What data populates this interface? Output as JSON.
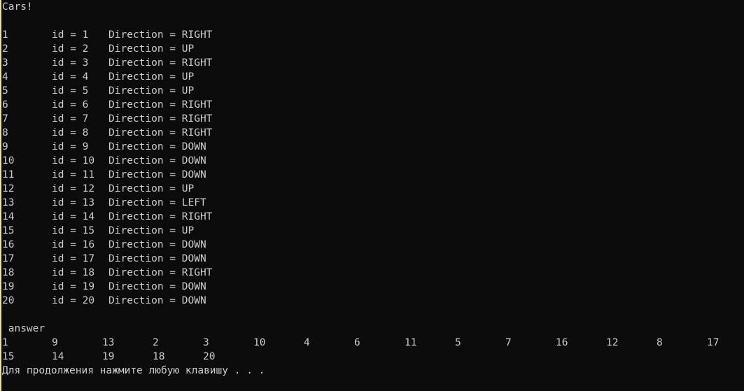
{
  "title": "Cars!",
  "cars": [
    {
      "n": "1",
      "id": "id = 1",
      "dir": "Direction = RIGHT"
    },
    {
      "n": "2",
      "id": "id = 2",
      "dir": "Direction = UP"
    },
    {
      "n": "3",
      "id": "id = 3",
      "dir": "Direction = RIGHT"
    },
    {
      "n": "4",
      "id": "id = 4",
      "dir": "Direction = UP"
    },
    {
      "n": "5",
      "id": "id = 5",
      "dir": "Direction = UP"
    },
    {
      "n": "6",
      "id": "id = 6",
      "dir": "Direction = RIGHT"
    },
    {
      "n": "7",
      "id": "id = 7",
      "dir": "Direction = RIGHT"
    },
    {
      "n": "8",
      "id": "id = 8",
      "dir": "Direction = RIGHT"
    },
    {
      "n": "9",
      "id": "id = 9",
      "dir": "Direction = DOWN"
    },
    {
      "n": "10",
      "id": "id = 10",
      "dir": "Direction = DOWN"
    },
    {
      "n": "11",
      "id": "id = 11",
      "dir": "Direction = DOWN"
    },
    {
      "n": "12",
      "id": "id = 12",
      "dir": "Direction = UP"
    },
    {
      "n": "13",
      "id": "id = 13",
      "dir": "Direction = LEFT"
    },
    {
      "n": "14",
      "id": "id = 14",
      "dir": "Direction = RIGHT"
    },
    {
      "n": "15",
      "id": "id = 15",
      "dir": "Direction = UP"
    },
    {
      "n": "16",
      "id": "id = 16",
      "dir": "Direction = DOWN"
    },
    {
      "n": "17",
      "id": "id = 17",
      "dir": "Direction = DOWN"
    },
    {
      "n": "18",
      "id": "id = 18",
      "dir": "Direction = RIGHT"
    },
    {
      "n": "19",
      "id": "id = 19",
      "dir": "Direction = DOWN"
    },
    {
      "n": "20",
      "id": "id = 20",
      "dir": "Direction = DOWN"
    }
  ],
  "answer_label": " answer",
  "answer_rows": [
    [
      "1",
      "9",
      "13",
      "2",
      "3",
      "10",
      "4",
      "6",
      "11",
      "5",
      "7",
      "16",
      "12",
      "8",
      "17"
    ],
    [
      "15",
      "14",
      "19",
      "18",
      "20"
    ]
  ],
  "prompt": "Для продолжения нажмите любую клавишу . . .",
  "colors": {
    "background": "#0c0c0c",
    "text": "#cccccc",
    "cursor_bar": "#e8e39b"
  }
}
